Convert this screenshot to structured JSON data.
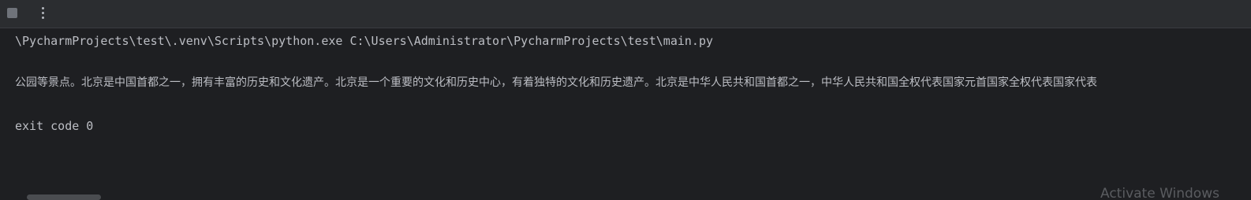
{
  "toolbar": {
    "stop_icon": "stop-icon",
    "more_icon": "more-vertical-icon"
  },
  "console": {
    "command_line": "\\PycharmProjects\\test\\.venv\\Scripts\\python.exe C:\\Users\\Administrator\\PycharmProjects\\test\\main.py",
    "output_line": "公园等景点。北京是中国首都之一，拥有丰富的历史和文化遗产。北京是一个重要的文化和历史中心，有着独特的文化和历史遗产。北京是中华人民共和国首都之一，中华人民共和国全权代表国家元首国家全权代表国家代表",
    "exit_line": "exit code 0"
  },
  "watermark": {
    "text": "Activate Windows"
  },
  "colors": {
    "background": "#1e1f22",
    "toolbar": "#2b2d30",
    "text": "#bcbec4"
  }
}
